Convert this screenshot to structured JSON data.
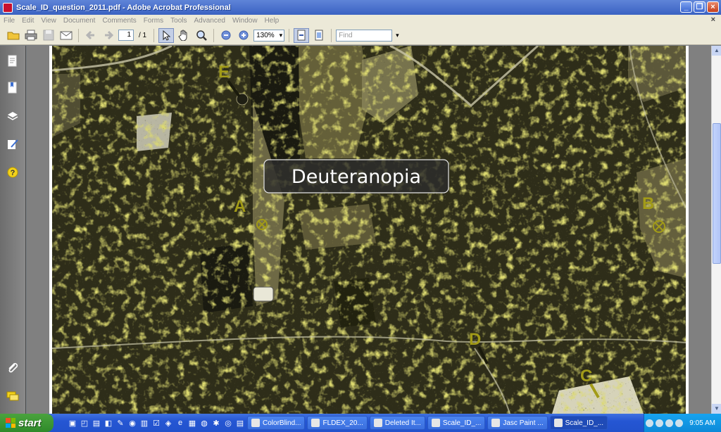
{
  "window": {
    "title": "Scale_ID_question_2011.pdf - Adobe Acrobat Professional",
    "controls": [
      "_",
      "❐",
      "×"
    ]
  },
  "menu": {
    "items": [
      "File",
      "Edit",
      "View",
      "Document",
      "Comments",
      "Forms",
      "Tools",
      "Advanced",
      "Window",
      "Help"
    ],
    "close_doc": "×"
  },
  "toolbar": {
    "page_current": "1",
    "page_total": "/ 1",
    "zoom": "130%",
    "find_placeholder": "Find"
  },
  "map": {
    "overlay_label": "Deuteranopia",
    "markers": [
      "A",
      "B",
      "C",
      "D",
      "E"
    ],
    "colors": {
      "base": "#2e2d19",
      "highlight": "#b9b730",
      "marker": "#a29b18",
      "label_bg": "#2c2c2c"
    }
  },
  "taskbar": {
    "start_label": "start",
    "tasks": [
      {
        "label": "ColorBlind...",
        "active": false
      },
      {
        "label": "FLDEX_20...",
        "active": false
      },
      {
        "label": "Deleted It...",
        "active": false
      },
      {
        "label": "Scale_ID_...",
        "active": false
      },
      {
        "label": "Jasc Paint ...",
        "active": false
      },
      {
        "label": "Scale_ID_...",
        "active": true
      }
    ],
    "clock": "9:05 AM"
  }
}
